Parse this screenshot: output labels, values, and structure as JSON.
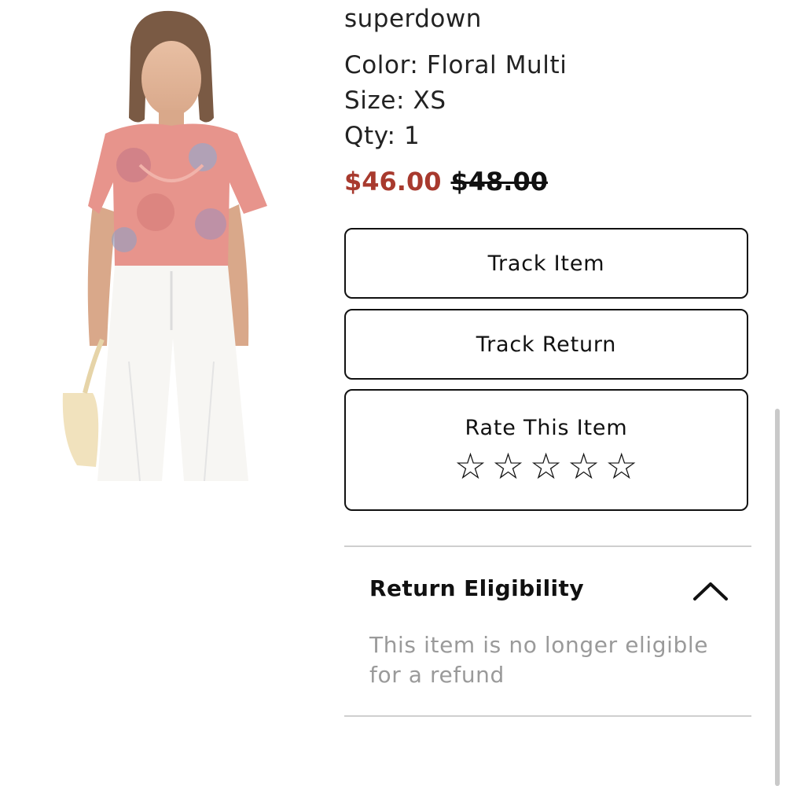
{
  "product": {
    "brand": "superdown",
    "color_label": "Color: Floral Multi",
    "size_label": "Size: XS",
    "qty_label": "Qty: 1",
    "sale_price": "$46.00",
    "original_price": "$48.00",
    "image": "product-photo"
  },
  "actions": {
    "track_item_label": "Track Item",
    "track_return_label": "Track Return",
    "rate_label": "Rate This Item",
    "stars": [
      "☆",
      "☆",
      "☆",
      "☆",
      "☆"
    ]
  },
  "return_eligibility": {
    "title": "Return Eligibility",
    "message": "This item is no longer eligible for a refund",
    "icon": "chevron-up-icon"
  },
  "colors": {
    "sale_price": "#a83a2e",
    "muted_text": "#9a9a9a",
    "divider": "#cfcfcf"
  }
}
